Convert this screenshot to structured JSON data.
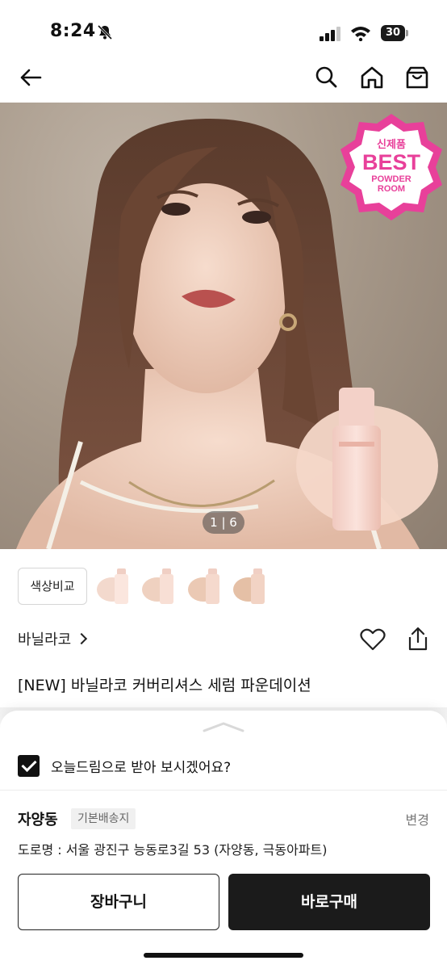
{
  "status_bar": {
    "time": "8:24",
    "battery": "30",
    "icons": [
      "bell-slash-icon",
      "signal-icon",
      "wifi-icon",
      "battery-icon"
    ]
  },
  "top_nav": {
    "icons": [
      "back-arrow-icon",
      "search-icon",
      "home-icon",
      "shopping-bag-icon"
    ]
  },
  "hero": {
    "badge": {
      "top": "신제품",
      "main": "BEST",
      "line1": "POWDER",
      "line2": "ROOM"
    },
    "pager": {
      "current": "1",
      "total": "6",
      "text": "1 | 6"
    },
    "accent_color": "#e8409a"
  },
  "shade_row": {
    "compare_label": "색상비교",
    "swatches": [
      {
        "color": "#f3d9cd"
      },
      {
        "color": "#efd1c0"
      },
      {
        "color": "#ebc9b4"
      },
      {
        "color": "#e5c0a6"
      }
    ]
  },
  "product": {
    "brand": "바닐라코",
    "title": "[NEW] 바닐라코 커버리셔스 세럼 파운데이션"
  },
  "bottom_sheet": {
    "dream_checkbox_label": "오늘드림으로 받아 보시겠어요?",
    "dream_checked": true,
    "address": {
      "name": "자양동",
      "tag": "기본배송지",
      "change": "변경",
      "line": "도로명 : 서울 광진구 능동로3길 53 (자양동, 극동아파트)"
    },
    "cart_button": "장바구니",
    "buy_button": "바로구매"
  }
}
